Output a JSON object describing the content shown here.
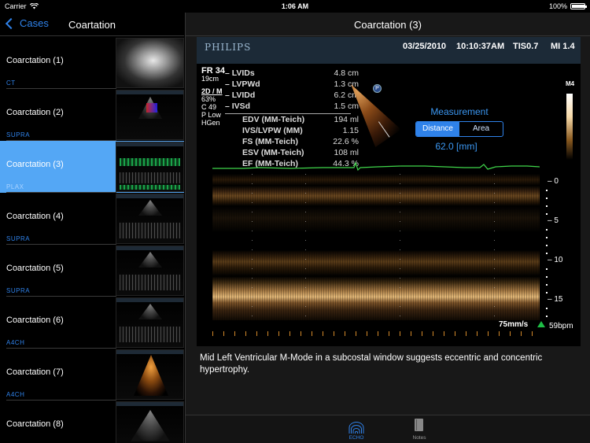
{
  "status_bar": {
    "carrier": "Carrier",
    "time": "1:06 AM",
    "battery": "100%",
    "battery_level": 1.0
  },
  "sidebar": {
    "back_label": "Cases",
    "title": "Coartation",
    "cases": [
      {
        "title": "Coarctation  (1)",
        "subtitle": "CT",
        "thumb": "ct"
      },
      {
        "title": "Coarctation  (2)",
        "subtitle": "SUPRA",
        "thumb": "color"
      },
      {
        "title": "Coarctation  (3)",
        "subtitle": "PLAX",
        "thumb": "mmode",
        "selected": true
      },
      {
        "title": "Coarctation  (4)",
        "subtitle": "SUPRA",
        "thumb": "doppler"
      },
      {
        "title": "Coarctation  (5)",
        "subtitle": "SUPRA",
        "thumb": "doppler"
      },
      {
        "title": "Coarctation  (6)",
        "subtitle": "A4CH",
        "thumb": "doppler"
      },
      {
        "title": "Coarctation  (7)",
        "subtitle": "A4CH",
        "thumb": "warm"
      },
      {
        "title": "Coarctation  (8)",
        "subtitle": "",
        "thumb": "sector"
      }
    ]
  },
  "content": {
    "title": "Coarctation  (3)",
    "echo": {
      "brand": "PHILIPS",
      "date": "03/25/2010",
      "clock": "10:10:37AM",
      "tis": "TIS0.7",
      "mi": "MI 1.4",
      "params": [
        "FR 34",
        "19cm",
        "2D / M",
        "63%",
        "C 49",
        "P Low",
        "HGen"
      ],
      "measurements_top": [
        {
          "label": "– LVIDs",
          "value": "4.8 cm"
        },
        {
          "label": "– LVPWd",
          "value": "1.3 cm"
        },
        {
          "label": "– LVIDd",
          "value": "6.2 cm"
        },
        {
          "label": "– IVSd",
          "value": "1.5 cm"
        }
      ],
      "measurements_calc": [
        {
          "label": "EDV (MM-Teich)",
          "value": "194 ml"
        },
        {
          "label": "IVS/LVPW (MM)",
          "value": "1.15"
        },
        {
          "label": "FS (MM-Teich)",
          "value": "22.6 %"
        },
        {
          "label": "ESV (MM-Teich)",
          "value": "108 ml"
        },
        {
          "label": "EF (MM-Teich)",
          "value": "44.3 %"
        }
      ],
      "probe_marker": "P",
      "greyscale_label": "M4",
      "depth_ticks": [
        "0",
        "5",
        "10",
        "15"
      ],
      "sweep_speed": "75mm/s",
      "heart_rate": "59bpm",
      "colors": {
        "ecg": "#3fd64a",
        "accent": "#2f82ea"
      }
    },
    "measurement_panel": {
      "title": "Measurement",
      "options": [
        "Distance",
        "Area"
      ],
      "selected": "Distance",
      "value": "62.0 [mm]"
    },
    "description": "Mid Left Ventricular M-Mode in a subcostal window suggests eccentric and concentric hypertrophy."
  },
  "tabbar": {
    "tabs": [
      {
        "label": "ECHO",
        "icon": "echo-waves-icon",
        "active": true
      },
      {
        "label": "Notes",
        "icon": "notebook-icon",
        "active": false
      }
    ]
  }
}
